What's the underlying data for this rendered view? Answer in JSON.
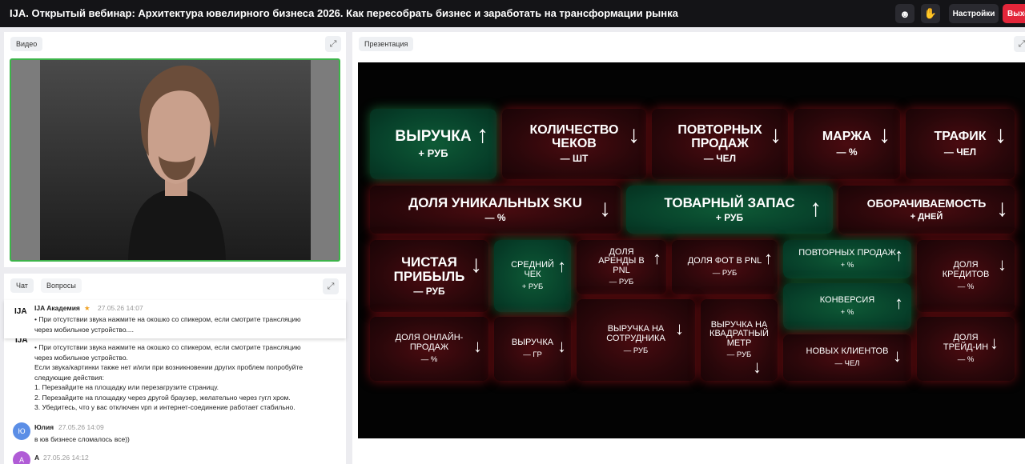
{
  "header": {
    "title": "IJA. Открытый вебинар: Архитектура ювелирного бизнеса 2026. Как пересобрать бизнес и заработать на трансформации рынка",
    "emoji_icon": "smile-icon",
    "hand_icon": "raise-hand-icon",
    "settings_label": "Настройки",
    "exit_label": "Выхо",
    "exit_color": "#e3263a"
  },
  "video": {
    "label": "Видео"
  },
  "chat": {
    "tab_chat": "Чат",
    "tab_questions": "Вопросы",
    "pinned": {
      "logo": "IJA",
      "author": "IJA Академия",
      "star": "★",
      "time": "27.05.26 14:07",
      "lines": [
        "• При отсутствии звука нажмите на окошко со спикером, если смотрите трансляцию",
        "через мобильное устройство...."
      ]
    },
    "messages": [
      {
        "logo": "IJA",
        "lines": [
          "• При отсутствии звука нажмите на окошко со спикером, если смотрите трансляцию",
          "через мобильное устройство.",
          "Если звука/картинки также нет и/или при возникновении других проблем попробуйте",
          "следующие действия:",
          "1. Перезайдите на площадку или перезагрузите страницу.",
          "2. Перезайдите на площадку через другой браузер, желательно через гугл хром.",
          "3. Убедитесь, что у вас отключен vpn и интернет-соединение работает стабильно."
        ]
      },
      {
        "avatar": "Ю",
        "avatar_color": "#5b8ee6",
        "author": "Юлия",
        "time": "27.05.26 14:09",
        "text": "в юв бизнесе сломалось все))"
      },
      {
        "avatar": "А",
        "avatar_color": "#b05cd6",
        "author": "А",
        "time": "27.05.26 14:12"
      }
    ]
  },
  "presentation": {
    "label": "Презентация",
    "tiles": [
      {
        "title": "ВЫРУЧКА",
        "sub": "+ РУБ",
        "arrow": "↑"
      },
      {
        "title": "КОЛИЧЕСТВО ЧЕКОВ",
        "sub": "— ШТ",
        "arrow": "↓"
      },
      {
        "title": "ПОВТОРНЫХ ПРОДАЖ",
        "sub": "— ЧЕЛ",
        "arrow": "↓"
      },
      {
        "title": "МАРЖА",
        "sub": "— %",
        "arrow": "↓"
      },
      {
        "title": "ТРАФИК",
        "sub": "— ЧЕЛ",
        "arrow": "↓"
      },
      {
        "title": "ДОЛЯ УНИКАЛЬНЫХ SKU",
        "sub": "— %",
        "arrow": "↓"
      },
      {
        "title": "ТОВАРНЫЙ ЗАПАС",
        "sub": "+ РУБ",
        "arrow": "↑"
      },
      {
        "title": "ОБОРАЧИВАЕМОСТЬ",
        "sub": "+ ДНЕЙ",
        "arrow": "↓"
      },
      {
        "title": "ЧИСТАЯ ПРИБЫЛЬ",
        "sub": "— РУБ",
        "arrow": "↓"
      },
      {
        "title": "СРЕДНИЙ ЧЕК",
        "sub": "+ РУБ",
        "arrow": "↑"
      },
      {
        "title": "ДОЛЯ АРЕНДЫ В PNL",
        "sub": "— РУБ",
        "arrow": "↑"
      },
      {
        "title": "ДОЛЯ ФОТ В PNL",
        "sub": "— РУБ",
        "arrow": "↑"
      },
      {
        "title": "ПОВТОРНЫХ ПРОДАЖ",
        "sub": "+ %",
        "arrow": "↑"
      },
      {
        "title": "ДОЛЯ КРЕДИТОВ",
        "sub": "— %",
        "arrow": "↓"
      },
      {
        "title": "КОНВЕРСИЯ",
        "sub": "+ %",
        "arrow": "↑"
      },
      {
        "title": "ДОЛЯ ОНЛАЙН-ПРОДАЖ",
        "sub": "— %",
        "arrow": "↓"
      },
      {
        "title": "ВЫРУЧКА",
        "sub": "— ГР",
        "arrow": "↓"
      },
      {
        "title": "ВЫРУЧКА НА СОТРУДНИКА",
        "sub": "— РУБ",
        "arrow": "↓"
      },
      {
        "title": "ВЫРУЧКА НА КВАДРАТНЫЙ МЕТР",
        "sub": "— РУБ",
        "arrow": "↓"
      },
      {
        "title": "НОВЫХ КЛИЕНТОВ",
        "sub": "— ЧЕЛ",
        "arrow": "↓"
      },
      {
        "title": "ДОЛЯ ТРЕЙД-ИН",
        "sub": "— %",
        "arrow": "↓"
      }
    ]
  }
}
